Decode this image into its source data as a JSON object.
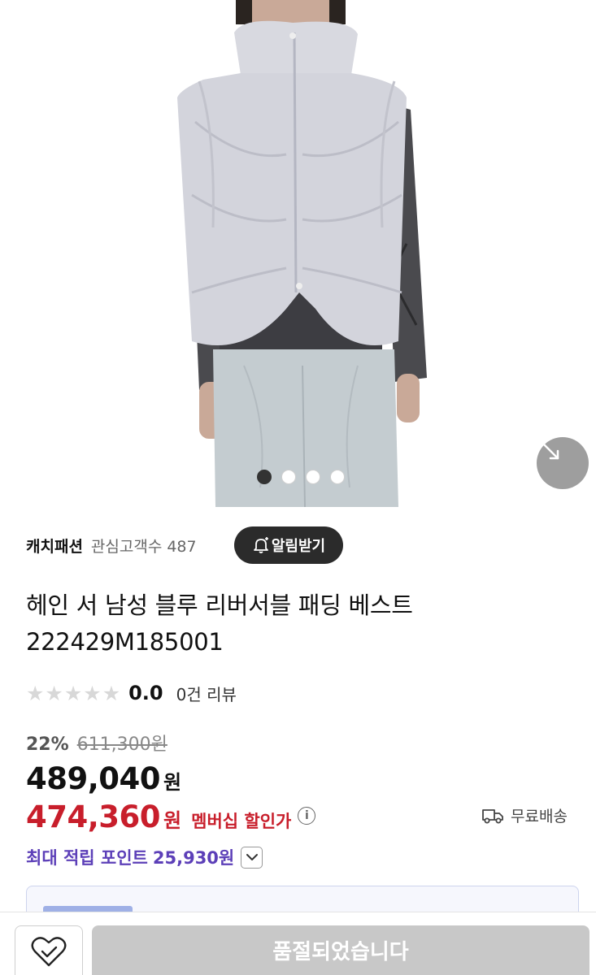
{
  "gallery": {
    "image_count": 4,
    "active_index": 0,
    "image_label": "light gray padded vest worn over dark gray long sleeve top",
    "expand_icon": "expand-arrows-icon"
  },
  "seller": {
    "name": "캐치패션",
    "follower_label": "관심고객수",
    "follower_count": "487",
    "alert_button": "알림받기",
    "alert_icon": "bell-plus-icon"
  },
  "product": {
    "title": "헤인 서 남성 블루 리버서블 패딩 베스트",
    "model_code": "222429M185001"
  },
  "rating": {
    "stars_filled": 0,
    "stars_total": 5,
    "score": "0.0",
    "review_count_text": "0건 리뷰"
  },
  "pricing": {
    "discount_rate": "22%",
    "original_price": "611,300원",
    "sale_price": "489,040",
    "currency": "원",
    "member_price": "474,360",
    "member_label": "멤버십 할인가",
    "info_icon": "info-icon"
  },
  "shipping": {
    "label": "무료배송",
    "icon": "truck-icon"
  },
  "points": {
    "label": "최대 적립 포인트",
    "value": "25,930원",
    "toggle_icon": "chevron-down-icon"
  },
  "bottom_bar": {
    "wishlist_icon": "heart-check-icon",
    "soldout_label": "품절되었습니다"
  },
  "colors": {
    "member_red": "#c81e2b",
    "points_purple": "#5c3fb8",
    "soldout_gray": "#c8c8c8",
    "dark_button": "#2b2b2b"
  }
}
